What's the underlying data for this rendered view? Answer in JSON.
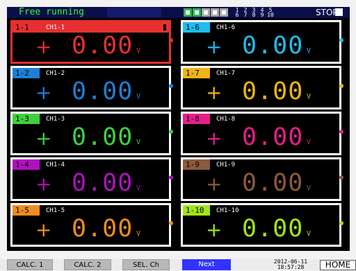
{
  "header": {
    "mode": "Free running",
    "indicators": [
      {
        "name": "indicator-1",
        "color": "#2db84a"
      },
      {
        "name": "indicator-2",
        "color": "#2db84a"
      },
      {
        "name": "indicator-3",
        "color": "#aaaaaa"
      },
      {
        "name": "indicator-4",
        "color": "#aaaaaa"
      },
      {
        "name": "indicator-5",
        "color": "#aaaaaa"
      }
    ],
    "channel_digits": [
      {
        "top": "1",
        "bottom": "6"
      },
      {
        "top": "2",
        "bottom": "7"
      },
      {
        "top": "3",
        "bottom": "8"
      },
      {
        "top": "4",
        "bottom": "9"
      },
      {
        "top": "5",
        "bottom": "10"
      }
    ],
    "stop_label": "STOP"
  },
  "channels": [
    {
      "tag": "1-1",
      "name": "CH1-1",
      "sign": "+",
      "value": "0.00",
      "unit": "V",
      "color": "#e63030",
      "selected": true
    },
    {
      "tag": "1-2",
      "name": "CH1-2",
      "sign": "+",
      "value": "0.00",
      "unit": "V",
      "color": "#1e7fd6"
    },
    {
      "tag": "1-3",
      "name": "CH1-3",
      "sign": "+",
      "value": "0.00",
      "unit": "V",
      "color": "#3ecf3e"
    },
    {
      "tag": "1-4",
      "name": "CH1-4",
      "sign": "+",
      "value": "0.00",
      "unit": "V",
      "color": "#b010c0"
    },
    {
      "tag": "1-5",
      "name": "CH1-5",
      "sign": "+",
      "value": "0.00",
      "unit": "V",
      "color": "#f08c1e"
    },
    {
      "tag": "1-6",
      "name": "CH1-6",
      "sign": "+",
      "value": "0.00",
      "unit": "V",
      "color": "#1ebcf0"
    },
    {
      "tag": "1-7",
      "name": "CH1-7",
      "sign": "+",
      "value": "0.00",
      "unit": "V",
      "color": "#f0b414"
    },
    {
      "tag": "1-8",
      "name": "CH1-8",
      "sign": "+",
      "value": "0.00",
      "unit": "V",
      "color": "#e61e8c"
    },
    {
      "tag": "1-9",
      "name": "CH1-9",
      "sign": "+",
      "value": "0.00",
      "unit": "V",
      "color": "#8c5a3c"
    },
    {
      "tag": "1-10",
      "name": "CH1-10",
      "sign": "+",
      "value": "0.00",
      "unit": "V",
      "color": "#a0e614"
    }
  ],
  "footer": {
    "buttons": [
      {
        "label": "CALC. 1",
        "name": "calc1-button"
      },
      {
        "label": "CALC. 2",
        "name": "calc2-button"
      },
      {
        "label": "SEL. Ch",
        "name": "sel-ch-button"
      },
      {
        "label": "Next",
        "name": "next-button"
      }
    ],
    "date": "2012-06-11",
    "time": "18:57:28",
    "home": "HOME"
  }
}
